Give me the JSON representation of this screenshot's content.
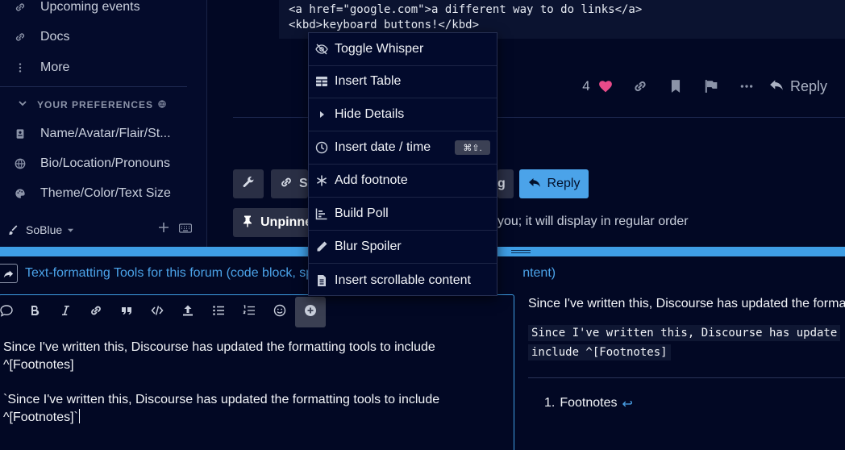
{
  "sidebar": {
    "items": [
      {
        "label": "Upcoming events",
        "icon": "link-icon"
      },
      {
        "label": "Docs",
        "icon": "link-icon"
      },
      {
        "label": "More",
        "icon": "vertical-ellipsis-icon"
      }
    ],
    "section_title": "YOUR PREFERENCES",
    "preferences": [
      {
        "label": "Name/Avatar/Flair/St...",
        "icon": "id-card-icon"
      },
      {
        "label": "Bio/Location/Pronouns",
        "icon": "globe-icon"
      },
      {
        "label": "Theme/Color/Text Size",
        "icon": "palette-icon"
      }
    ],
    "footer": {
      "theme_label": "SoBlue"
    }
  },
  "post": {
    "code_lines": [
      "<a href=\"google.com\">a different way to do links</a>",
      "<kbd>keyboard buttons!</kbd>"
    ],
    "like_count": "4",
    "reply_label": "Reply"
  },
  "topic": {
    "share_label": "S",
    "partial_label": "g",
    "reply_label": "Reply",
    "unpin_label": "Unpinne",
    "pin_notice": "you; it will display in regular order"
  },
  "composer": {
    "reply_to_title": "Text-formatting Tools for this forum (code block, sp",
    "reply_to_title_tail": "ntent)",
    "editor_lines": [
      "Since I've written this, Discourse has updated the formatting tools to include ^[Footnotes]",
      "`Since I've written this, Discourse has updated the formatting tools to include ^[Footnotes]`"
    ],
    "preview": {
      "paragraph": "Since I've written this, Discourse has updated the forma",
      "code_line1": "Since I've written this, Discourse has update",
      "code_line2": "include ^[Footnotes]",
      "footnote_number": "1.",
      "footnote_text": "Footnotes",
      "footnote_back": "↩"
    }
  },
  "menu": {
    "items": [
      {
        "label": "Toggle Whisper",
        "icon": "eye-slash-icon"
      },
      {
        "label": "Insert Table",
        "icon": "table-icon"
      },
      {
        "label": "Hide Details",
        "icon": "caret-right-icon"
      },
      {
        "label": "Insert date / time",
        "icon": "clock-icon",
        "shortcut": "⌘⇧."
      },
      {
        "label": "Add footnote",
        "icon": "asterisk-icon"
      },
      {
        "label": "Build Poll",
        "icon": "chart-bar-icon"
      },
      {
        "label": "Blur Spoiler",
        "icon": "pencil-icon"
      },
      {
        "label": "Insert scrollable content",
        "icon": "scroll-file-icon"
      }
    ]
  },
  "colors": {
    "accent": "#4ba3e9",
    "background": "#020824",
    "like_heart": "#e94b8a"
  }
}
